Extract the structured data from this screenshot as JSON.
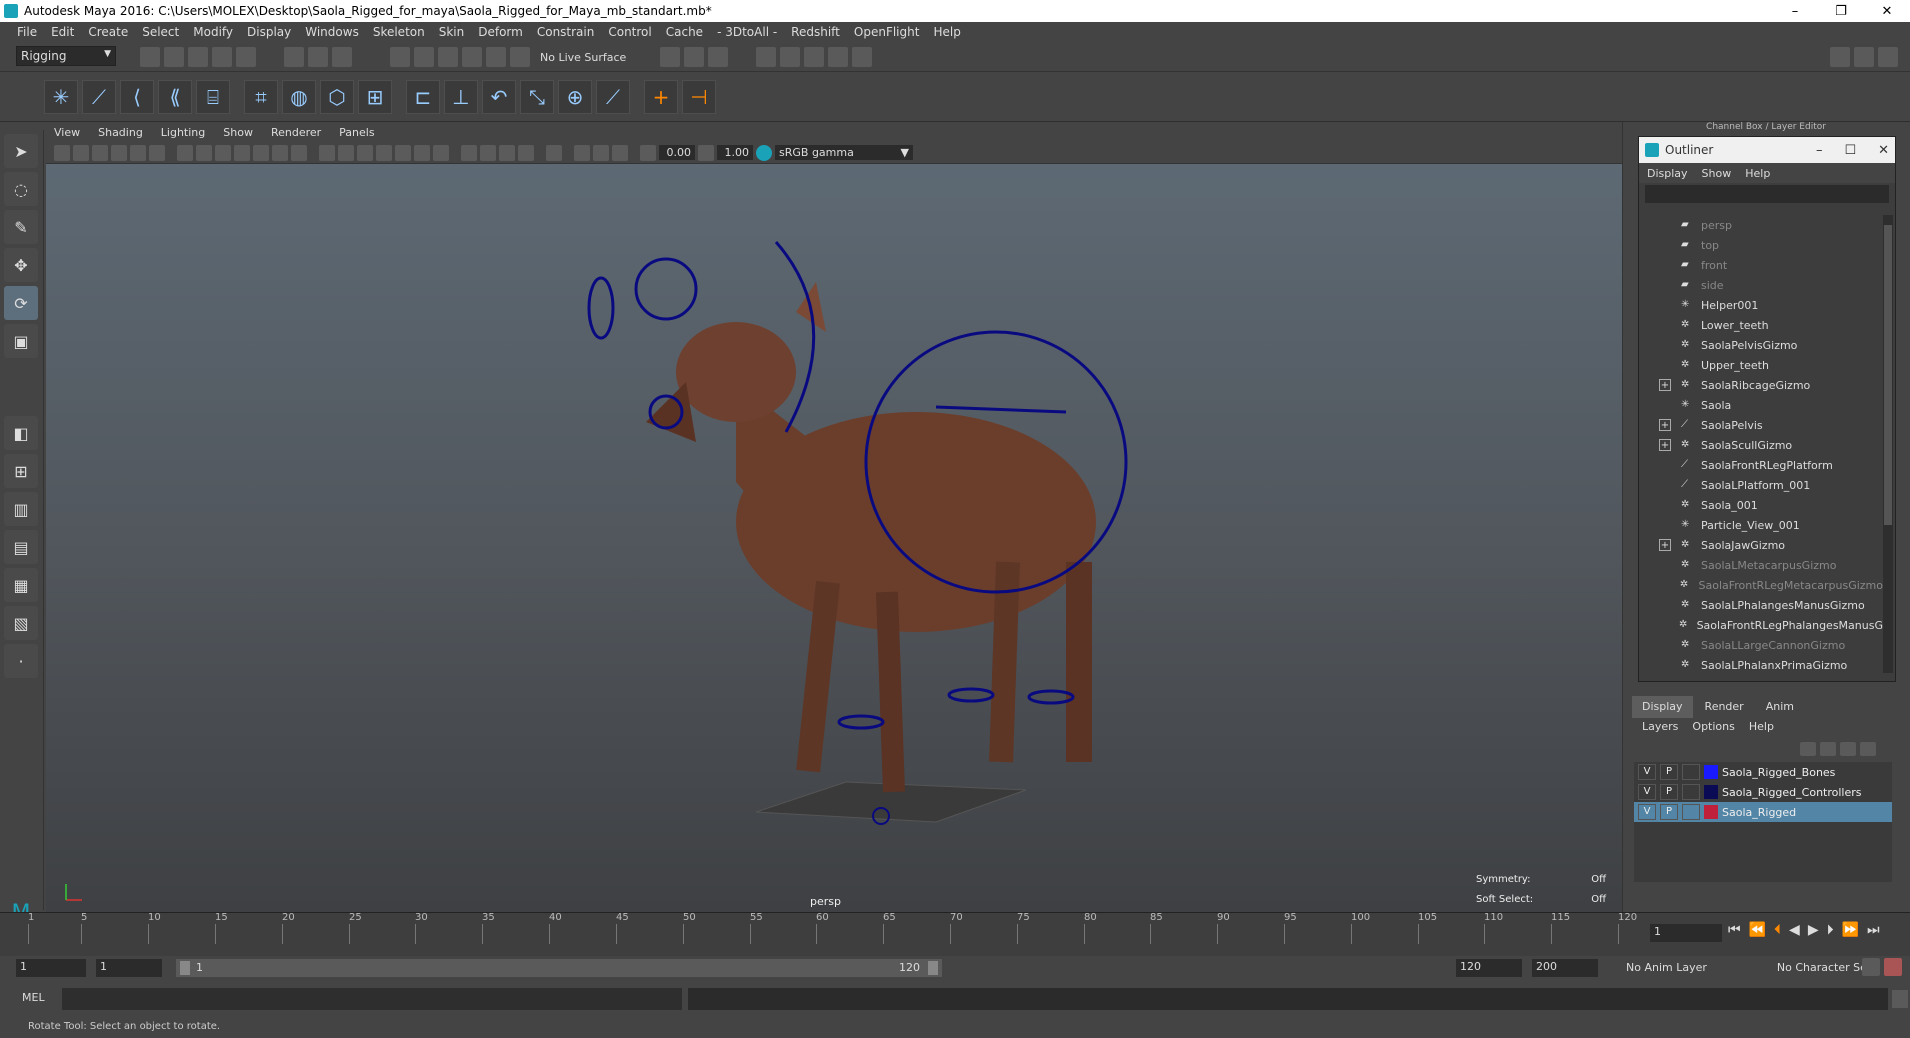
{
  "window": {
    "title": "Autodesk Maya 2016: C:\\Users\\MOLEX\\Desktop\\Saola_Rigged_for_maya\\Saola_Rigged_for_Maya_mb_standart.mb*",
    "min": "–",
    "restore": "❐",
    "close": "✕"
  },
  "menubar": [
    "File",
    "Edit",
    "Create",
    "Select",
    "Modify",
    "Display",
    "Windows",
    "Skeleton",
    "Skin",
    "Deform",
    "Constrain",
    "Control",
    "Cache",
    "- 3DtoAll -",
    "Redshift",
    "OpenFlight",
    "Help"
  ],
  "statusline": {
    "mode": "Rigging",
    "live_surface": "No Live Surface"
  },
  "viewport": {
    "menu": [
      "View",
      "Shading",
      "Lighting",
      "Show",
      "Renderer",
      "Panels"
    ],
    "exposure": "0.00",
    "gamma": "1.00",
    "color_space": "sRGB gamma",
    "camera_label": "persp",
    "symmetry_label": "Symmetry:",
    "symmetry_value": "Off",
    "soft_select_label": "Soft Select:",
    "soft_select_value": "Off"
  },
  "right_panel": {
    "header": "Channel Box / Layer Editor",
    "outliner": {
      "title": "Outliner",
      "menu": [
        "Display",
        "Show",
        "Help"
      ],
      "items": [
        {
          "label": "persp",
          "type": "camera",
          "expand": false,
          "dim": true
        },
        {
          "label": "top",
          "type": "camera",
          "expand": false,
          "dim": true
        },
        {
          "label": "front",
          "type": "camera",
          "expand": false,
          "dim": true
        },
        {
          "label": "side",
          "type": "camera",
          "expand": false,
          "dim": true
        },
        {
          "label": "Helper001",
          "type": "star",
          "expand": false,
          "dim": false
        },
        {
          "label": "Lower_teeth",
          "type": "mesh",
          "expand": false,
          "dim": false
        },
        {
          "label": "SaolaPelvisGizmo",
          "type": "mesh",
          "expand": false,
          "dim": false
        },
        {
          "label": "Upper_teeth",
          "type": "mesh",
          "expand": false,
          "dim": false
        },
        {
          "label": "SaolaRibcageGizmo",
          "type": "mesh",
          "expand": true,
          "dim": false
        },
        {
          "label": "Saola",
          "type": "star",
          "expand": false,
          "dim": false
        },
        {
          "label": "SaolaPelvis",
          "type": "joint",
          "expand": true,
          "dim": false
        },
        {
          "label": "SaolaScullGizmo",
          "type": "mesh",
          "expand": true,
          "dim": false
        },
        {
          "label": "SaolaFrontRLegPlatform",
          "type": "joint",
          "expand": false,
          "dim": false
        },
        {
          "label": "SaolaLPlatform_001",
          "type": "joint",
          "expand": false,
          "dim": false
        },
        {
          "label": "Saola_001",
          "type": "mesh",
          "expand": false,
          "dim": false
        },
        {
          "label": "Particle_View_001",
          "type": "star",
          "expand": false,
          "dim": false
        },
        {
          "label": "SaolaJawGizmo",
          "type": "mesh",
          "expand": true,
          "dim": false
        },
        {
          "label": "SaolaLMetacarpusGizmo",
          "type": "mesh",
          "expand": false,
          "dim": true
        },
        {
          "label": "SaolaFrontRLegMetacarpusGizmo",
          "type": "mesh",
          "expand": false,
          "dim": true
        },
        {
          "label": "SaolaLPhalangesManusGizmo",
          "type": "mesh",
          "expand": false,
          "dim": false
        },
        {
          "label": "SaolaFrontRLegPhalangesManusG",
          "type": "mesh",
          "expand": false,
          "dim": false
        },
        {
          "label": "SaolaLLargeCannonGizmo",
          "type": "mesh",
          "expand": false,
          "dim": true
        },
        {
          "label": "SaolaLPhalanxPrimaGizmo",
          "type": "mesh",
          "expand": false,
          "dim": false
        }
      ]
    },
    "layer_tabs": [
      "Display",
      "Render",
      "Anim"
    ],
    "layer_menu": [
      "Layers",
      "Options",
      "Help"
    ],
    "layers": [
      {
        "v": "V",
        "p": "P",
        "color": "#1a1aff",
        "name": "Saola_Rigged_Bones",
        "selected": false
      },
      {
        "v": "V",
        "p": "P",
        "color": "#0a0a55",
        "name": "Saola_Rigged_Controllers",
        "selected": false
      },
      {
        "v": "V",
        "p": "P",
        "color": "#c0203a",
        "name": "Saola_Rigged",
        "selected": true
      }
    ]
  },
  "timeline": {
    "ticks": [
      "1",
      "5",
      "10",
      "15",
      "20",
      "25",
      "30",
      "35",
      "40",
      "45",
      "50",
      "55",
      "60",
      "65",
      "70",
      "75",
      "80",
      "85",
      "90",
      "95",
      "100",
      "105",
      "110",
      "115",
      "120"
    ],
    "current_frame": "1",
    "range_start": "1",
    "range_start2": "1",
    "slider_start": "1",
    "slider_end": "120",
    "range_end": "120",
    "anim_end": "200",
    "anim_layer": "No Anim Layer",
    "character_set": "No Character Set"
  },
  "command": {
    "mel_label": "MEL",
    "help_text": "Rotate Tool: Select an object to rotate."
  }
}
